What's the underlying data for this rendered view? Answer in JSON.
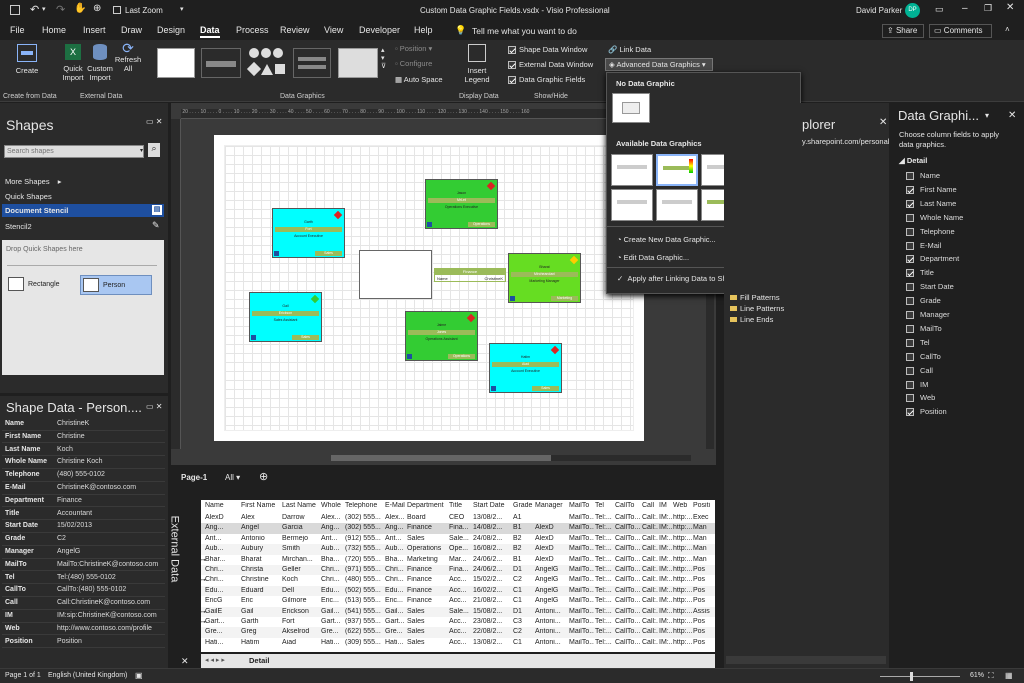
{
  "titlebar": {
    "autosave": "Last Zoom",
    "doc_title": "Custom Data Graphic Fields.vsdx  -  Visio Professional",
    "user": "David Parker",
    "initials": "DP"
  },
  "menu": {
    "tabs": [
      "File",
      "Home",
      "Insert",
      "Draw",
      "Design",
      "Data",
      "Process",
      "Review",
      "View",
      "Developer",
      "Help"
    ],
    "search": "Tell me what you want to do",
    "share": "Share",
    "comments": "Comments"
  },
  "ribbon": {
    "create": "Create",
    "quick_import": "Quick Import",
    "custom_import": "Custom Import",
    "refresh_all": "Refresh All",
    "group_create": "Create from Data",
    "group_external": "External Data",
    "group_graphics": "Data Graphics",
    "group_display": "Display Data",
    "group_showhide": "Show/Hide",
    "position": "Position",
    "configure": "Configure",
    "auto_space": "Auto Space",
    "insert_legend": "Insert Legend",
    "shape_data_window": "Shape Data Window",
    "external_data_window": "External Data Window",
    "data_graphic_fields": "Data Graphic Fields",
    "link_data": "Link Data",
    "advanced": "Advanced Data Graphics"
  },
  "shapes_panel": {
    "title": "Shapes",
    "search_placeholder": "Search shapes",
    "more_shapes": "More Shapes",
    "quick_shapes": "Quick Shapes",
    "document_stencil": "Document Stencil",
    "stencil2": "Stencil2",
    "drop_hint": "Drop Quick Shapes here",
    "rectangle": "Rectangle",
    "person": "Person"
  },
  "shape_data": {
    "title": "Shape Data - Person....",
    "rows": [
      {
        "k": "Name",
        "v": "ChristineK"
      },
      {
        "k": "First Name",
        "v": "Christine"
      },
      {
        "k": "Last Name",
        "v": "Koch"
      },
      {
        "k": "Whole Name",
        "v": "Christine Koch"
      },
      {
        "k": "Telephone",
        "v": "(480) 555-0102"
      },
      {
        "k": "E-Mail",
        "v": "ChristineK@contoso.com"
      },
      {
        "k": "Department",
        "v": "Finance"
      },
      {
        "k": "Title",
        "v": "Accountant"
      },
      {
        "k": "Start Date",
        "v": "15/02/2013"
      },
      {
        "k": "Grade",
        "v": "C2"
      },
      {
        "k": "Manager",
        "v": "AngelG"
      },
      {
        "k": "MailTo",
        "v": "MailTo:ChristineK@contoso.com"
      },
      {
        "k": "Tel",
        "v": "Tel:(480) 555-0102"
      },
      {
        "k": "CallTo",
        "v": "CallTo:(480) 555-0102"
      },
      {
        "k": "Call",
        "v": "Call:ChristineK@contoso.com"
      },
      {
        "k": "IM",
        "v": "IM:sip:ChristineK@contoso.com"
      },
      {
        "k": "Web",
        "v": "http://www.contoso.com/profile"
      },
      {
        "k": "Position",
        "v": "Position"
      }
    ]
  },
  "canvas": {
    "shapes": [
      {
        "name": "Garth",
        "line2": "Fort",
        "line3": "Account Executive",
        "foot": "Sales"
      },
      {
        "name": "Jason",
        "line2": "MrLet",
        "line3": "Operations Executive",
        "foot": "Operations"
      },
      {
        "name": "Bharat",
        "line2": "Mircheandani",
        "line3": "Marketing Manager",
        "foot": "Marketing"
      },
      {
        "name": "Gail",
        "line2": "Erickson",
        "line3": "Sales Assistant",
        "foot": "Sales"
      },
      {
        "name": "Jaime",
        "line2": "Jones",
        "line3": "Operations Assistant",
        "foot": "Operations"
      },
      {
        "name": "Hatim",
        "line2": "Aiad",
        "line3": "Account Executive",
        "foot": "Sales"
      }
    ],
    "legend_head": "Finance",
    "legend_name": "Name",
    "legend_val": "ChristineK",
    "page_tab": "Page-1",
    "all": "All"
  },
  "dropdown": {
    "no_data": "No Data Graphic",
    "available": "Available Data Graphics",
    "create_new": "Create New Data Graphic...",
    "edit": "Edit Data Graphic...",
    "apply": "Apply after Linking Data to Shapes"
  },
  "explorer": {
    "title": "plorer",
    "url": "y.sharepoint.com/personal",
    "items": [
      "Fill Patterns",
      "Line Patterns",
      "Line Ends"
    ]
  },
  "dgf_panel": {
    "title": "Data Graphi...",
    "hint": "Choose column fields to apply data graphics.",
    "group": "Detail",
    "fields": [
      {
        "n": "Name",
        "c": false
      },
      {
        "n": "First Name",
        "c": true
      },
      {
        "n": "Last Name",
        "c": true
      },
      {
        "n": "Whole Name",
        "c": false
      },
      {
        "n": "Telephone",
        "c": false
      },
      {
        "n": "E-Mail",
        "c": false
      },
      {
        "n": "Department",
        "c": true
      },
      {
        "n": "Title",
        "c": true
      },
      {
        "n": "Start Date",
        "c": false
      },
      {
        "n": "Grade",
        "c": false
      },
      {
        "n": "Manager",
        "c": false
      },
      {
        "n": "MailTo",
        "c": false
      },
      {
        "n": "Tel",
        "c": false
      },
      {
        "n": "CallTo",
        "c": false
      },
      {
        "n": "Call",
        "c": false
      },
      {
        "n": "IM",
        "c": false
      },
      {
        "n": "Web",
        "c": false
      },
      {
        "n": "Position",
        "c": true
      }
    ]
  },
  "external": {
    "label": "External Data",
    "detail_tab": "Detail",
    "headers": [
      "Name",
      "First Name",
      "Last Name",
      "Whole",
      "Telephone",
      "E-Mail",
      "Department",
      "Title",
      "Start Date",
      "Grade",
      "Manager",
      "MailTo",
      "Tel",
      "CallTo",
      "Call",
      "IM",
      "Web",
      "Positi"
    ],
    "rows": [
      [
        "AlexD",
        "Alex",
        "Darrow",
        "Alex...",
        "(302) 555...",
        "Alex...",
        "Board",
        "CEO",
        "13/08/2...",
        "A1",
        "",
        "MailTo...",
        "Tel:...",
        "CallTo...",
        "Call:...",
        "IM:...",
        "http:...",
        "Exec"
      ],
      [
        "Ang...",
        "Angel",
        "Garcia",
        "Ang...",
        "(302) 555...",
        "Ang...",
        "Finance",
        "Fina...",
        "14/08/2...",
        "B1",
        "AlexD",
        "MailTo...",
        "Tel:...",
        "CallTo...",
        "Call:...",
        "IM:...",
        "http:...",
        "Man"
      ],
      [
        "Ant...",
        "Antonio",
        "Bermejo",
        "Ant...",
        "(912) 555...",
        "Ant...",
        "Sales",
        "Sale...",
        "24/08/2...",
        "B2",
        "AlexD",
        "MailTo...",
        "Tel:...",
        "CallTo...",
        "Call:...",
        "IM:...",
        "http:...",
        "Man"
      ],
      [
        "Aub...",
        "Aubury",
        "Smith",
        "Aub...",
        "(732) 555...",
        "Aub...",
        "Operations",
        "Ope...",
        "16/08/2...",
        "B2",
        "AlexD",
        "MailTo...",
        "Tel:...",
        "CallTo...",
        "Call:...",
        "IM:...",
        "http:...",
        "Man"
      ],
      [
        "Bhar...",
        "Bharat",
        "Mirchan...",
        "Bha...",
        "(720) 555...",
        "Bha...",
        "Marketing",
        "Mar...",
        "24/06/2...",
        "B1",
        "AlexD",
        "MailTo...",
        "Tel:...",
        "CallTo...",
        "Call:...",
        "IM:...",
        "http:...",
        "Man"
      ],
      [
        "Chri...",
        "Christa",
        "Geller",
        "Chri...",
        "(971) 555...",
        "Chri...",
        "Finance",
        "Fina...",
        "24/06/2...",
        "D1",
        "AngelG",
        "MailTo...",
        "Tel:...",
        "CallTo...",
        "Call:...",
        "IM:...",
        "http:...",
        "Pos"
      ],
      [
        "Chri...",
        "Christine",
        "Koch",
        "Chri...",
        "(480) 555...",
        "Chri...",
        "Finance",
        "Acc...",
        "15/02/2...",
        "C2",
        "AngelG",
        "MailTo...",
        "Tel:...",
        "CallTo...",
        "Call:...",
        "IM:...",
        "http:...",
        "Pos"
      ],
      [
        "Edu...",
        "Eduard",
        "Dell",
        "Edu...",
        "(502) 555...",
        "Edu...",
        "Finance",
        "Acc...",
        "16/02/2...",
        "C1",
        "AngelG",
        "MailTo...",
        "Tel:...",
        "CallTo...",
        "Call:...",
        "IM:...",
        "http:...",
        "Pos"
      ],
      [
        "EricG",
        "Eric",
        "Gilmore",
        "Eric...",
        "(513) 555...",
        "Eric...",
        "Finance",
        "Acc...",
        "21/08/2...",
        "C1",
        "AngelG",
        "MailTo...",
        "Tel:...",
        "CallTo...",
        "Call:...",
        "IM:...",
        "http:...",
        "Pos"
      ],
      [
        "GailE",
        "Gail",
        "Erickson",
        "Gail...",
        "(541) 555...",
        "Gail...",
        "Sales",
        "Sale...",
        "15/08/2...",
        "D1",
        "Antoni...",
        "MailTo...",
        "Tel:...",
        "CallTo...",
        "Call:...",
        "IM:...",
        "http:...",
        "Assis"
      ],
      [
        "Gart...",
        "Garth",
        "Fort",
        "Gart...",
        "(937) 555...",
        "Gart...",
        "Sales",
        "Acc...",
        "23/08/2...",
        "C3",
        "Antoni...",
        "MailTo...",
        "Tel:...",
        "CallTo...",
        "Call:...",
        "IM:...",
        "http:...",
        "Pos"
      ],
      [
        "Gre...",
        "Greg",
        "Akselrod",
        "Gre...",
        "(622) 555...",
        "Gre...",
        "Sales",
        "Acc...",
        "22/08/2...",
        "C2",
        "Antoni...",
        "MailTo...",
        "Tel:...",
        "CallTo...",
        "Call:...",
        "IM:...",
        "http:...",
        "Pos"
      ],
      [
        "Hati...",
        "Hatim",
        "Aiad",
        "Hati...",
        "(309) 555...",
        "Hati...",
        "Sales",
        "Acc...",
        "13/08/2...",
        "C1",
        "Antoni...",
        "MailTo...",
        "Tel:...",
        "CallTo...",
        "Call:...",
        "IM:...",
        "http:...",
        "Pos"
      ]
    ]
  },
  "status": {
    "page": "Page 1 of 1",
    "lang": "English (United Kingdom)",
    "zoom": "61%"
  },
  "colors": {
    "accent": "#00b294",
    "cyan": "#00ffff",
    "green": "#33cc33",
    "bar": "#9bbb59",
    "highlight": "#1e4fa0"
  }
}
